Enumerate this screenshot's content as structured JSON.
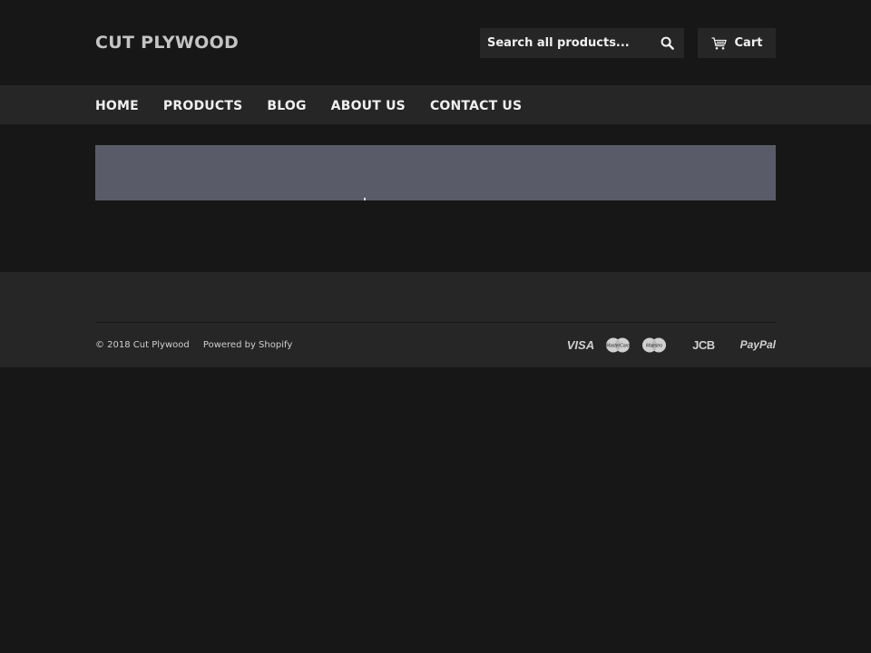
{
  "header": {
    "site_title": "CUT PLYWOOD",
    "search_placeholder": "Search all products...",
    "search_icon": "search-icon",
    "cart_label": "Cart",
    "cart_icon": "cart-icon"
  },
  "nav": {
    "items": [
      {
        "label": "HOME"
      },
      {
        "label": "PRODUCTS"
      },
      {
        "label": "BLOG"
      },
      {
        "label": "ABOUT US"
      },
      {
        "label": "CONTACT US"
      }
    ]
  },
  "hero": {
    "background_color": "#595b68"
  },
  "footer": {
    "copyright": "© 2018 Cut Plywood",
    "powered_by": "Powered by Shopify",
    "payment_icons": [
      {
        "name": "visa-icon",
        "label": "VISA"
      },
      {
        "name": "mastercard-icon",
        "label": "MasterCard"
      },
      {
        "name": "maestro-icon",
        "label": "Maestro"
      },
      {
        "name": "jcb-icon",
        "label": "JCB"
      },
      {
        "name": "paypal-icon",
        "label": "PayPal"
      }
    ]
  },
  "colors": {
    "page_bg": "#171717",
    "bar_bg": "#262626",
    "text": "#f0f0f0",
    "title": "#c4c4c4"
  }
}
